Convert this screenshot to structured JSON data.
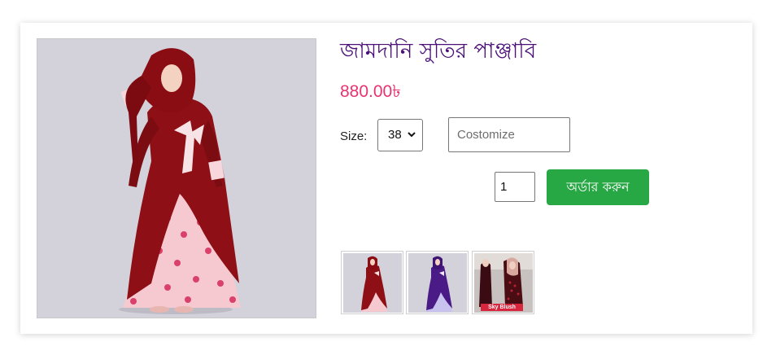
{
  "product": {
    "title": "জামদানি সুতির পাঞ্জাবি",
    "price": "880.00৳"
  },
  "options": {
    "size_label": "Size:",
    "size_value": "38",
    "customize_placeholder": "Costomize",
    "quantity_value": "1"
  },
  "actions": {
    "order_label": "অর্ডার করুন"
  },
  "gallery": {
    "thumbnails": [
      "thumbnail-maroon-floral",
      "thumbnail-purple",
      "thumbnail-black-red-hijab"
    ],
    "badge_text": "Sky Blush"
  },
  "colors": {
    "title": "#4b1178",
    "price": "#e8336f",
    "order_button": "#28a745"
  }
}
